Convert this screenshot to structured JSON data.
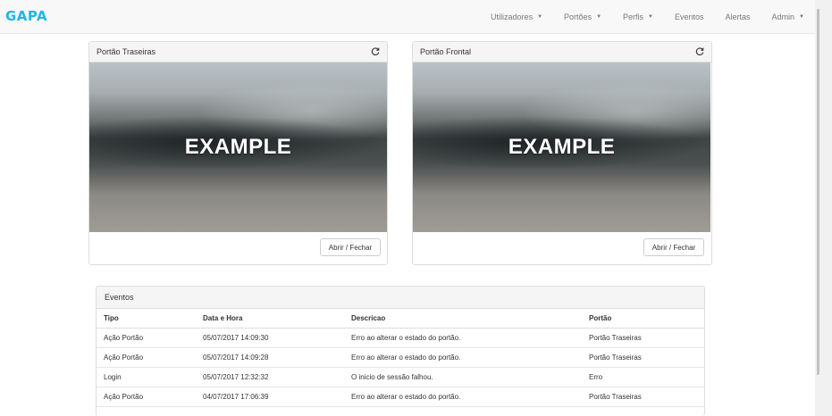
{
  "navbar": {
    "brand": "GAPA",
    "items": [
      {
        "label": "Utilizadores",
        "dropdown": true
      },
      {
        "label": "Portões",
        "dropdown": true
      },
      {
        "label": "Perfis",
        "dropdown": true
      },
      {
        "label": "Eventos",
        "dropdown": false
      },
      {
        "label": "Alertas",
        "dropdown": false
      },
      {
        "label": "Admin",
        "dropdown": true
      }
    ],
    "caret": "▼"
  },
  "cameras": [
    {
      "title": "Portão Traseiras",
      "image_text": "EXAMPLE",
      "button": "Abrir / Fechar"
    },
    {
      "title": "Portão Frontal",
      "image_text": "EXAMPLE",
      "button": "Abrir / Fechar"
    }
  ],
  "events": {
    "title": "Eventos",
    "columns": [
      "Tipo",
      "Data e Hora",
      "Descricao",
      "Portão"
    ],
    "rows": [
      [
        "Ação Portão",
        "05/07/2017 14:09:30",
        "Erro ao alterar o estado do portão.",
        "Portão Traseiras"
      ],
      [
        "Ação Portão",
        "05/07/2017 14:09:28",
        "Erro ao alterar o estado do portão.",
        "Portão Traseiras"
      ],
      [
        "Login",
        "05/07/2017 12:32:32",
        "O inicio de sessão falhou.",
        "Erro"
      ],
      [
        "Ação Portão",
        "04/07/2017 17:06:39",
        "Erro ao alterar o estado do portão.",
        "Portão Traseiras"
      ]
    ]
  },
  "colors": {
    "brand": "#1fb6e6",
    "navbar_bg": "#f8f8f8",
    "panel_heading_bg": "#f5f5f5"
  }
}
